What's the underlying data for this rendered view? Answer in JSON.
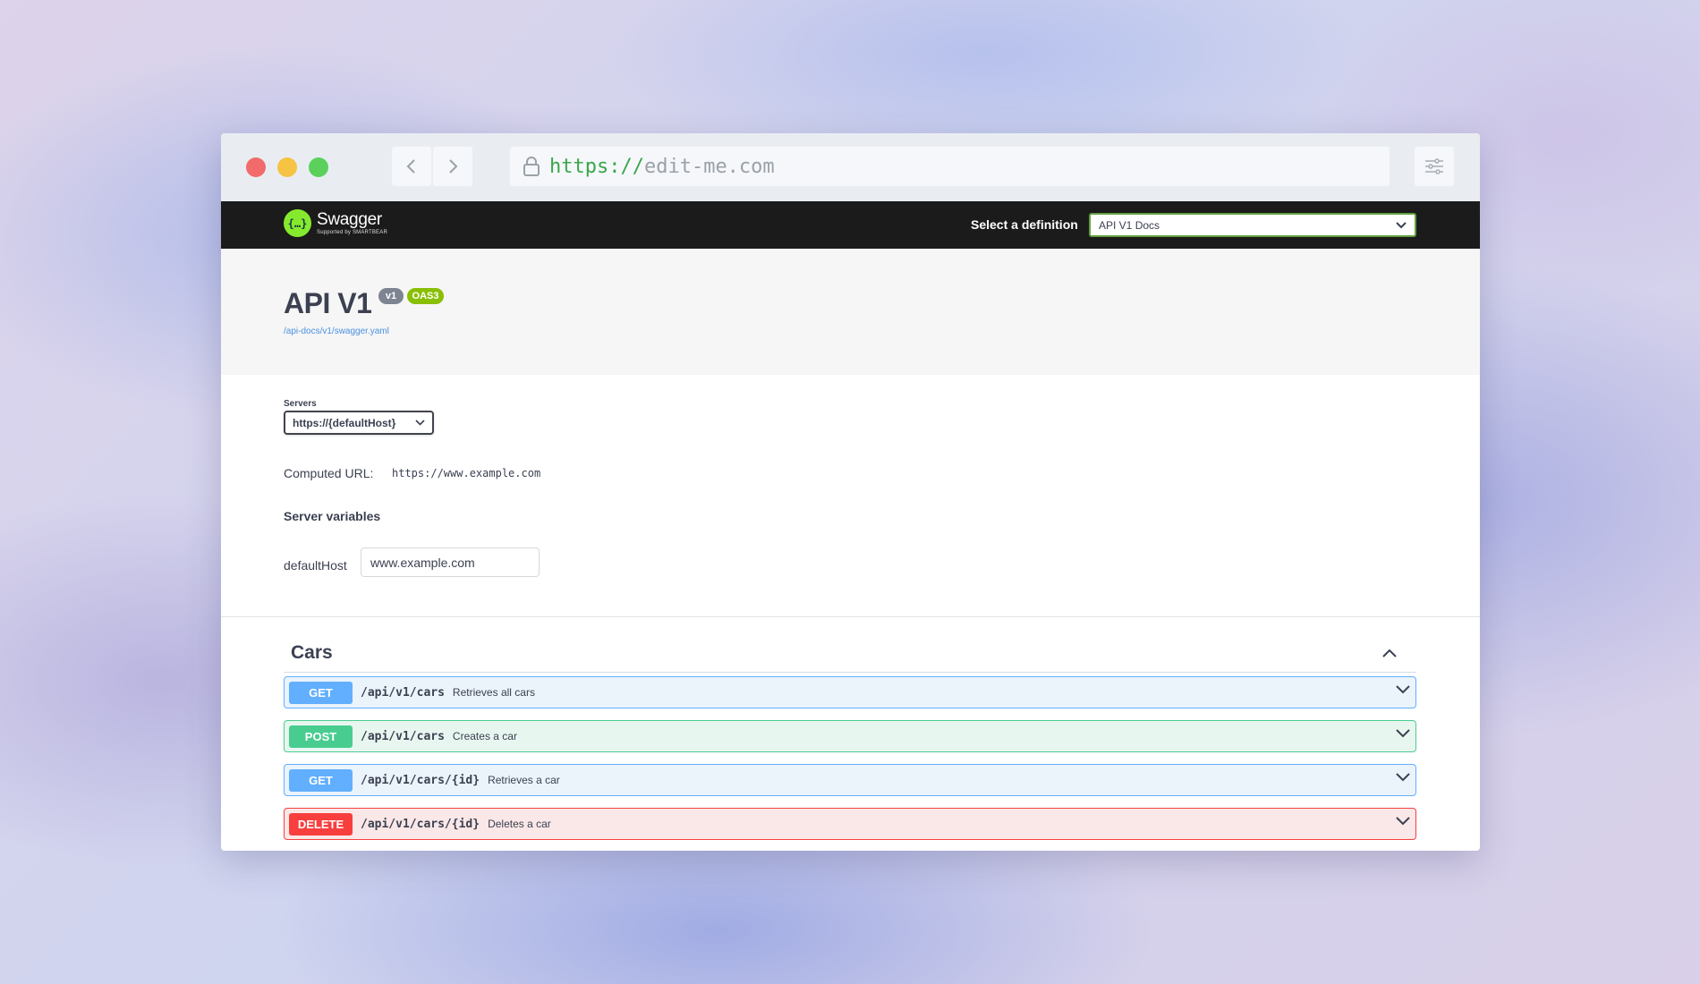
{
  "browser": {
    "url_scheme": "https://",
    "url_host": "edit-me.com"
  },
  "topbar": {
    "logo_name": "Swagger",
    "logo_sub": "Supported by SMARTBEAR",
    "definition_label": "Select a definition",
    "definition_selected": "API V1 Docs"
  },
  "info": {
    "title": "API V1",
    "version_badge": "v1",
    "oas_badge": "OAS3",
    "spec_link": "/api-docs/v1/swagger.yaml"
  },
  "servers": {
    "label": "Servers",
    "selected": "https://{defaultHost}",
    "computed_label": "Computed URL:",
    "computed_url": "https://www.example.com",
    "variables_heading": "Server variables",
    "variable_name": "defaultHost",
    "variable_value": "www.example.com"
  },
  "tag": {
    "name": "Cars",
    "operations": [
      {
        "method": "GET",
        "path": "/api/v1/cars",
        "summary": "Retrieves all cars"
      },
      {
        "method": "POST",
        "path": "/api/v1/cars",
        "summary": "Creates a car"
      },
      {
        "method": "GET",
        "path": "/api/v1/cars/{id}",
        "summary": "Retrieves a car"
      },
      {
        "method": "DELETE",
        "path": "/api/v1/cars/{id}",
        "summary": "Deletes a car"
      }
    ]
  },
  "colors": {
    "get": "#61affe",
    "post": "#49cc90",
    "delete": "#f93e3e",
    "swagger_green": "#85ea2d"
  }
}
